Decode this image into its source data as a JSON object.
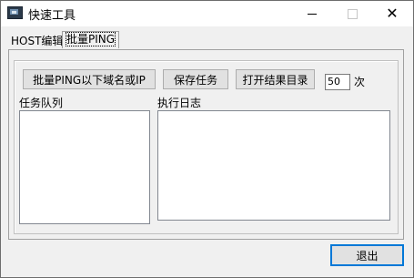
{
  "window": {
    "title": "快速工具"
  },
  "tabs": [
    {
      "label": "HOST编辑",
      "selected": false
    },
    {
      "label": "批量PING",
      "selected": true
    }
  ],
  "toolbar": {
    "ping_button": "批量PING以下域名或IP",
    "save_button": "保存任务",
    "open_button": "打开结果目录",
    "count_value": "50",
    "count_unit": "次"
  },
  "panels": {
    "queue_label": "任务队列",
    "log_label": "执行日志"
  },
  "footer": {
    "exit_button": "退出"
  }
}
